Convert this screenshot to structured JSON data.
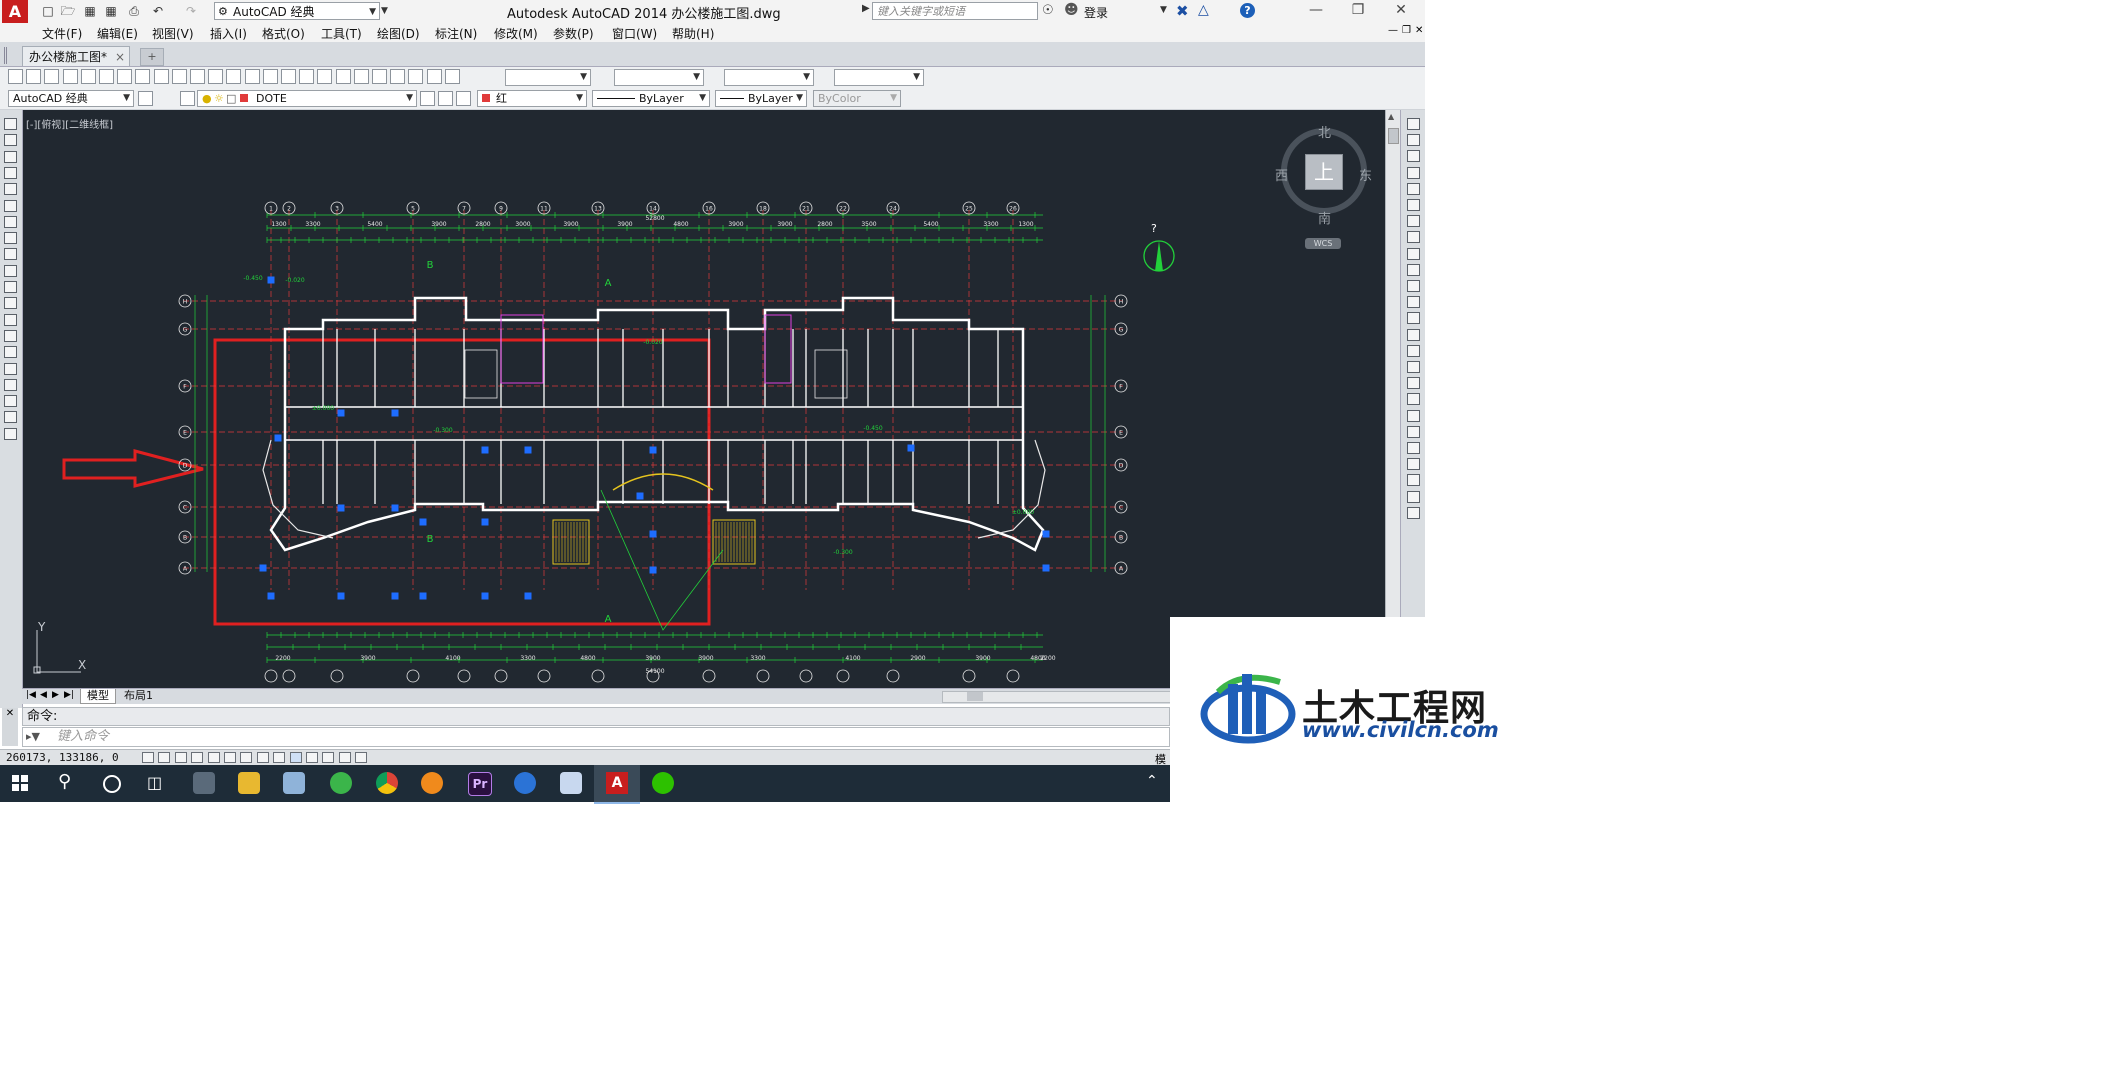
{
  "titlebar": {
    "workspace": "AutoCAD 经典",
    "title": "Autodesk AutoCAD 2014    办公楼施工图.dwg",
    "search_placeholder": "键入关键字或短语",
    "login": "登录"
  },
  "menu": {
    "items": [
      "文件(F)",
      "编辑(E)",
      "视图(V)",
      "插入(I)",
      "格式(O)",
      "工具(T)",
      "绘图(D)",
      "标注(N)",
      "修改(M)",
      "参数(P)",
      "窗口(W)",
      "帮助(H)"
    ]
  },
  "tabs": {
    "document": "办公楼施工图*",
    "close_glyph": "×"
  },
  "toolbar2": {
    "workspace": "AutoCAD 经典",
    "layer": "DOTE",
    "color": "红",
    "linetype": "ByLayer",
    "lineweight": "ByLayer",
    "plotstyle": "ByColor"
  },
  "viewport": {
    "label": "[-][俯视][二维线框]"
  },
  "viewcube": {
    "north": "北",
    "south": "南",
    "east": "东",
    "west": "西",
    "top": "上",
    "wcs": "WCS"
  },
  "ucs": {
    "x": "X",
    "y": "Y"
  },
  "north_arrow": "?",
  "layout_tabs": {
    "model": "模型",
    "layout1": "布局1"
  },
  "command": {
    "history": "命令:",
    "placeholder": "键入命令"
  },
  "status": {
    "coords": "260173, 133186, 0",
    "right": "模"
  },
  "watermark": {
    "name": "土木工程网",
    "url": "www.civilcn.com"
  },
  "drawing": {
    "grid_top": [
      "1",
      "2",
      "3",
      "5",
      "7",
      "9",
      "11",
      "13",
      "14",
      "16",
      "18",
      "21",
      "22",
      "24",
      "25",
      "26"
    ],
    "grid_left": [
      "H",
      "G",
      "F",
      "E",
      "D",
      "C",
      "B",
      "A"
    ],
    "top_dims": [
      "1300",
      "3300",
      "5400",
      "3900",
      "2800",
      "3000",
      "3900",
      "3900",
      "4800",
      "3900",
      "3900",
      "2800",
      "3500",
      "5400",
      "3300",
      "1300"
    ],
    "total_dim": "52800",
    "bottom_dims": [
      "2200",
      "3900",
      "4100",
      "3300",
      "4800",
      "3900",
      "3900",
      "3300",
      "4100",
      "2900",
      "3900",
      "4800",
      "2200"
    ],
    "bottom_total": "54100",
    "section_labels": [
      "B",
      "A",
      "A",
      "B"
    ],
    "levels": [
      "±0.000",
      "-0.300",
      "-0.020",
      "-0.450"
    ]
  },
  "colors": {
    "canvas": "#212830",
    "dim_green": "#22d13a",
    "wall": "#ffffff",
    "red_axis": "#e03a3a",
    "highlight_red": "#e02020",
    "grip_blue": "#1e6dff",
    "yellow": "#e5c41e",
    "magenta": "#e040e0"
  }
}
